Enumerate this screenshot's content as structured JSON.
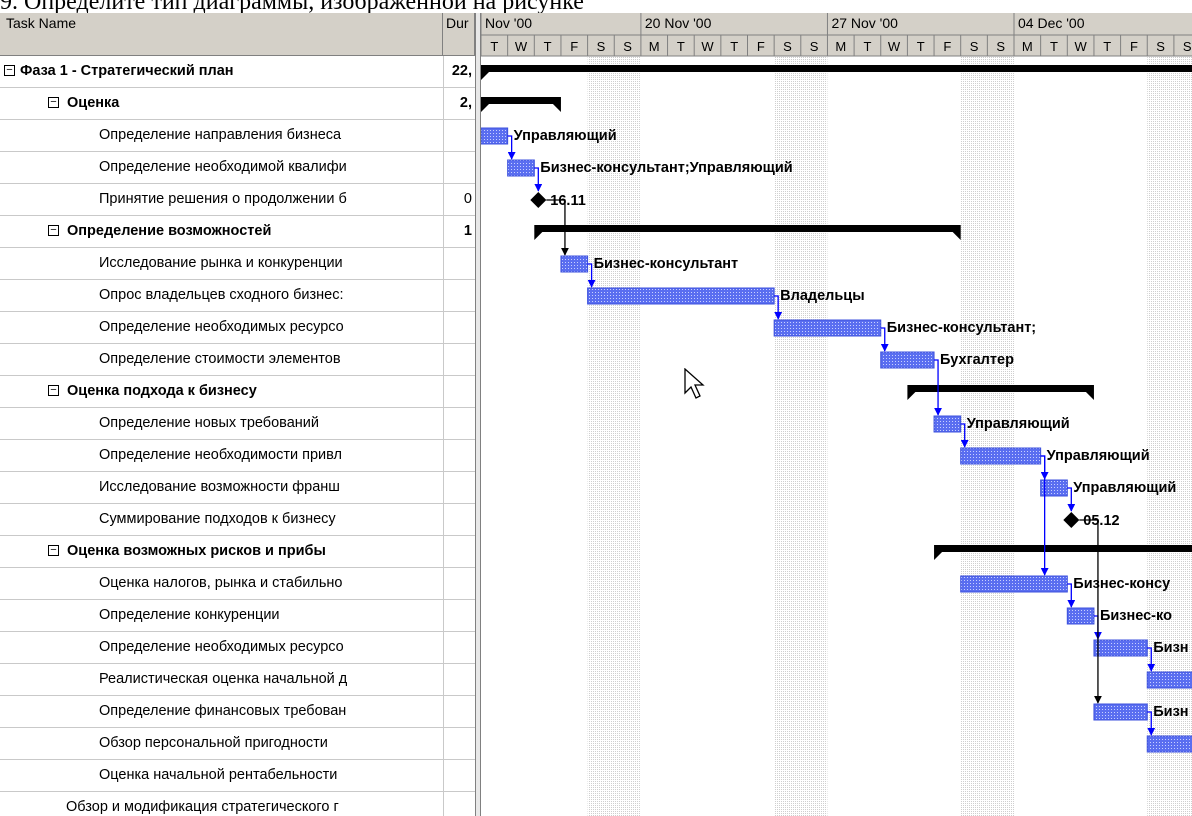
{
  "caption": "9. Определите тип диаграммы, изображенной на рисунке",
  "table": {
    "col_task": "Task Name",
    "col_duration": "Dur",
    "rows": [
      {
        "name": "Фаза 1 - Стратегический план",
        "dur": "22,",
        "level": 0,
        "summary": true
      },
      {
        "name": "Оценка",
        "dur": "2,",
        "level": 1,
        "summary": true
      },
      {
        "name": "Определение направления бизнеса",
        "dur": "",
        "level": 2,
        "summary": false
      },
      {
        "name": "Определение необходимой квалифи",
        "dur": "",
        "level": 2,
        "summary": false
      },
      {
        "name": "Принятие решения о продолжении б",
        "dur": "0",
        "level": 2,
        "summary": false
      },
      {
        "name": "Определение возможностей",
        "dur": "1",
        "level": 1,
        "summary": true
      },
      {
        "name": "Исследование рынка и конкуренции",
        "dur": "",
        "level": 2,
        "summary": false
      },
      {
        "name": "Опрос владельцев сходного бизнес:",
        "dur": "",
        "level": 2,
        "summary": false
      },
      {
        "name": "Определение необходимых ресурсо",
        "dur": "",
        "level": 2,
        "summary": false
      },
      {
        "name": "Определение стоимости элементов",
        "dur": "",
        "level": 2,
        "summary": false
      },
      {
        "name": "Оценка подхода к бизнесу",
        "dur": "",
        "level": 1,
        "summary": true
      },
      {
        "name": "Определение новых требований",
        "dur": "",
        "level": 2,
        "summary": false
      },
      {
        "name": "Определение необходимости  привл",
        "dur": "",
        "level": 2,
        "summary": false
      },
      {
        "name": "Исследование возможности франш",
        "dur": "",
        "level": 2,
        "summary": false
      },
      {
        "name": "Суммирование подходов к бизнесу",
        "dur": "",
        "level": 2,
        "summary": false
      },
      {
        "name": "Оценка возможных рисков и прибы",
        "dur": "",
        "level": 1,
        "summary": true
      },
      {
        "name": "Оценка налогов, рынка и стабильно",
        "dur": "",
        "level": 2,
        "summary": false
      },
      {
        "name": "Определение конкуренции",
        "dur": "",
        "level": 2,
        "summary": false
      },
      {
        "name": "Определение необходимых ресурсо",
        "dur": "",
        "level": 2,
        "summary": false
      },
      {
        "name": "Реалистическая оценка начальной д",
        "dur": "",
        "level": 2,
        "summary": false
      },
      {
        "name": "Определение финансовых требован",
        "dur": "",
        "level": 2,
        "summary": false
      },
      {
        "name": "Обзор персональной пригодности",
        "dur": "",
        "level": 2,
        "summary": false
      },
      {
        "name": "Оценка начальной рентабельности",
        "dur": "",
        "level": 2,
        "summary": false
      },
      {
        "name": "Обзор и модификация стратегического г",
        "dur": "",
        "level": 1.3,
        "summary": false
      }
    ]
  },
  "timescale": {
    "weeks": [
      "Nov '00",
      "20 Nov '00",
      "27 Nov '00",
      "04 Dec '00"
    ],
    "day_letters": [
      "T",
      "W",
      "T",
      "F",
      "S",
      "S",
      "M",
      "T",
      "W",
      "T",
      "F",
      "S",
      "S",
      "M",
      "T",
      "W",
      "T",
      "F",
      "S",
      "S",
      "M",
      "T",
      "W",
      "T",
      "F",
      "S",
      "S"
    ],
    "first_day": "2000-11-14"
  },
  "colors": {
    "task_bar": "#3c50dc",
    "task_bar_fill": "#5a6ef0",
    "summary_bar": "#000000",
    "link": "#0000ff",
    "weekend_shade": "#ededed",
    "header_bg": "#d4d0c8"
  },
  "gantt": {
    "summary_bars": [
      {
        "row": 0,
        "start": "2000-11-14",
        "end": "2000-12-12"
      },
      {
        "row": 1,
        "start": "2000-11-14",
        "end": "2000-11-16"
      },
      {
        "row": 5,
        "start": "2000-11-16",
        "end": "2000-12-01"
      },
      {
        "row": 10,
        "start": "2000-11-30",
        "end": "2000-12-06"
      },
      {
        "row": 15,
        "start": "2000-12-01",
        "end": "2000-12-12"
      }
    ],
    "tasks": [
      {
        "row": 2,
        "start": "2000-11-14",
        "end": "2000-11-14",
        "label": "Управляющий"
      },
      {
        "row": 3,
        "start": "2000-11-15",
        "end": "2000-11-15",
        "label": "Бизнес-консультант;Управляющий"
      },
      {
        "row": 6,
        "start": "2000-11-17",
        "end": "2000-11-17",
        "label": "Бизнес-консультант"
      },
      {
        "row": 7,
        "start": "2000-11-18",
        "end": "2000-11-24",
        "label": "Владельцы"
      },
      {
        "row": 8,
        "start": "2000-11-25",
        "end": "2000-11-28",
        "label": "Бизнес-консультант;"
      },
      {
        "row": 9,
        "start": "2000-11-29",
        "end": "2000-11-30",
        "label": "Бухгалтер"
      },
      {
        "row": 11,
        "start": "2000-12-01",
        "end": "2000-12-01",
        "label": "Управляющий"
      },
      {
        "row": 12,
        "start": "2000-12-02",
        "end": "2000-12-04",
        "label": "Управляющий"
      },
      {
        "row": 13,
        "start": "2000-12-05",
        "end": "2000-12-05",
        "label": "Управляющий"
      },
      {
        "row": 16,
        "start": "2000-12-02",
        "end": "2000-12-05",
        "label": "Бизнес-консу"
      },
      {
        "row": 17,
        "start": "2000-12-06",
        "end": "2000-12-06",
        "label": "Бизнес-ко"
      },
      {
        "row": 18,
        "start": "2000-12-07",
        "end": "2000-12-08",
        "label": "Бизн"
      },
      {
        "row": 19,
        "start": "2000-12-09",
        "end": "2000-12-11",
        "label": ""
      },
      {
        "row": 20,
        "start": "2000-12-07",
        "end": "2000-12-08",
        "label": "Бизн"
      },
      {
        "row": 21,
        "start": "2000-12-09",
        "end": "2000-12-11",
        "label": ""
      }
    ],
    "milestones": [
      {
        "row": 4,
        "date": "2000-11-16",
        "label": "16.11"
      },
      {
        "row": 14,
        "date": "2000-12-06",
        "label": "05.12"
      }
    ],
    "links": [
      {
        "from": 2,
        "to": 3
      },
      {
        "from": 3,
        "to": 4
      },
      {
        "from": 4,
        "to": 6
      },
      {
        "from": 6,
        "to": 7
      },
      {
        "from": 7,
        "to": 8
      },
      {
        "from": 8,
        "to": 9
      },
      {
        "from": 9,
        "to": 11
      },
      {
        "from": 11,
        "to": 12
      },
      {
        "from": 12,
        "to": 13
      },
      {
        "from": 13,
        "to": 14
      },
      {
        "from": 12,
        "to": 16
      },
      {
        "from": 16,
        "to": 17
      },
      {
        "from": 17,
        "to": 18
      },
      {
        "from": 18,
        "to": 19
      },
      {
        "from": 14,
        "to": 20
      },
      {
        "from": 20,
        "to": 21
      }
    ]
  }
}
